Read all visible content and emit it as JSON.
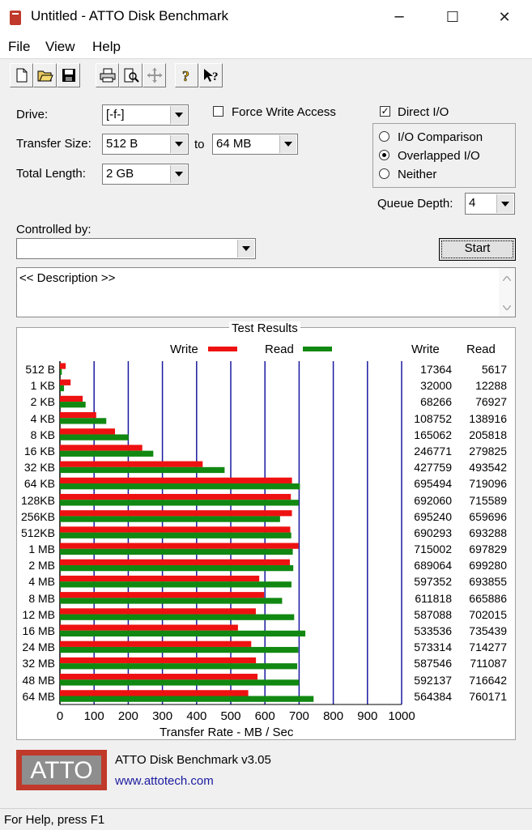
{
  "window": {
    "title": "Untitled - ATTO Disk Benchmark",
    "minimize": "─",
    "maximize": "☐",
    "close": "✕"
  },
  "menu": [
    "File",
    "View",
    "Help"
  ],
  "toolbar": {
    "icons": [
      "new-icon",
      "open-icon",
      "save-icon",
      "print-icon",
      "print-preview-icon",
      "move-icon",
      "help-icon",
      "context-help-icon"
    ]
  },
  "settings": {
    "drive_label": "Drive:",
    "drive_value": "[-f-]",
    "transfer_size_label": "Transfer Size:",
    "transfer_from": "512 B",
    "to_label": "to",
    "transfer_to": "64 MB",
    "total_length_label": "Total Length:",
    "total_length_value": "2 GB",
    "force_write_label": "Force Write Access",
    "direct_io_label": "Direct I/O",
    "direct_io_checked": "✓",
    "io_comparison_label": "I/O Comparison",
    "overlapped_io_label": "Overlapped I/O",
    "neither_label": "Neither",
    "queue_depth_label": "Queue Depth:",
    "queue_depth_value": "4",
    "controlled_by_label": "Controlled by:",
    "controlled_by_value": "",
    "start_label": "Start",
    "description": "<< Description >>"
  },
  "results": {
    "group_title": "Test Results",
    "legend_write": "Write",
    "legend_read": "Read",
    "col_write": "Write",
    "col_read": "Read",
    "x_axis_label": "Transfer Rate - MB / Sec",
    "write_color": "#ee1111",
    "read_color": "#118811",
    "grid_color": "#1a1aa0"
  },
  "chart_data": {
    "type": "bar",
    "orientation": "horizontal",
    "categories": [
      "512 B",
      "1 KB",
      "2 KB",
      "4 KB",
      "8 KB",
      "16 KB",
      "32 KB",
      "64 KB",
      "128KB",
      "256KB",
      "512KB",
      "1 MB",
      "2 MB",
      "4 MB",
      "8 MB",
      "12 MB",
      "16 MB",
      "24 MB",
      "32 MB",
      "48 MB",
      "64 MB"
    ],
    "series": [
      {
        "name": "Write",
        "values": [
          17364,
          32000,
          68266,
          108752,
          165062,
          246771,
          427759,
          695494,
          692060,
          695240,
          690293,
          715002,
          689064,
          597352,
          611818,
          587088,
          533536,
          573314,
          587546,
          592137,
          564384
        ]
      },
      {
        "name": "Read",
        "values": [
          5617,
          12288,
          76927,
          138916,
          205818,
          279825,
          493542,
          719096,
          715589,
          659696,
          693288,
          697829,
          699280,
          693855,
          665886,
          702015,
          735439,
          714277,
          711087,
          716642,
          760171
        ]
      }
    ],
    "xlabel": "Transfer Rate - MB / Sec",
    "xlim": [
      0,
      1000
    ],
    "xticks": [
      "0",
      "100",
      "200",
      "300",
      "400",
      "500",
      "600",
      "700",
      "800",
      "900",
      "1000"
    ],
    "grid": true,
    "legend": "top"
  },
  "footer": {
    "logo_text": "ATTO",
    "app_version": "ATTO Disk Benchmark v3.05",
    "website": "www.attotech.com",
    "status": "For Help, press F1"
  }
}
